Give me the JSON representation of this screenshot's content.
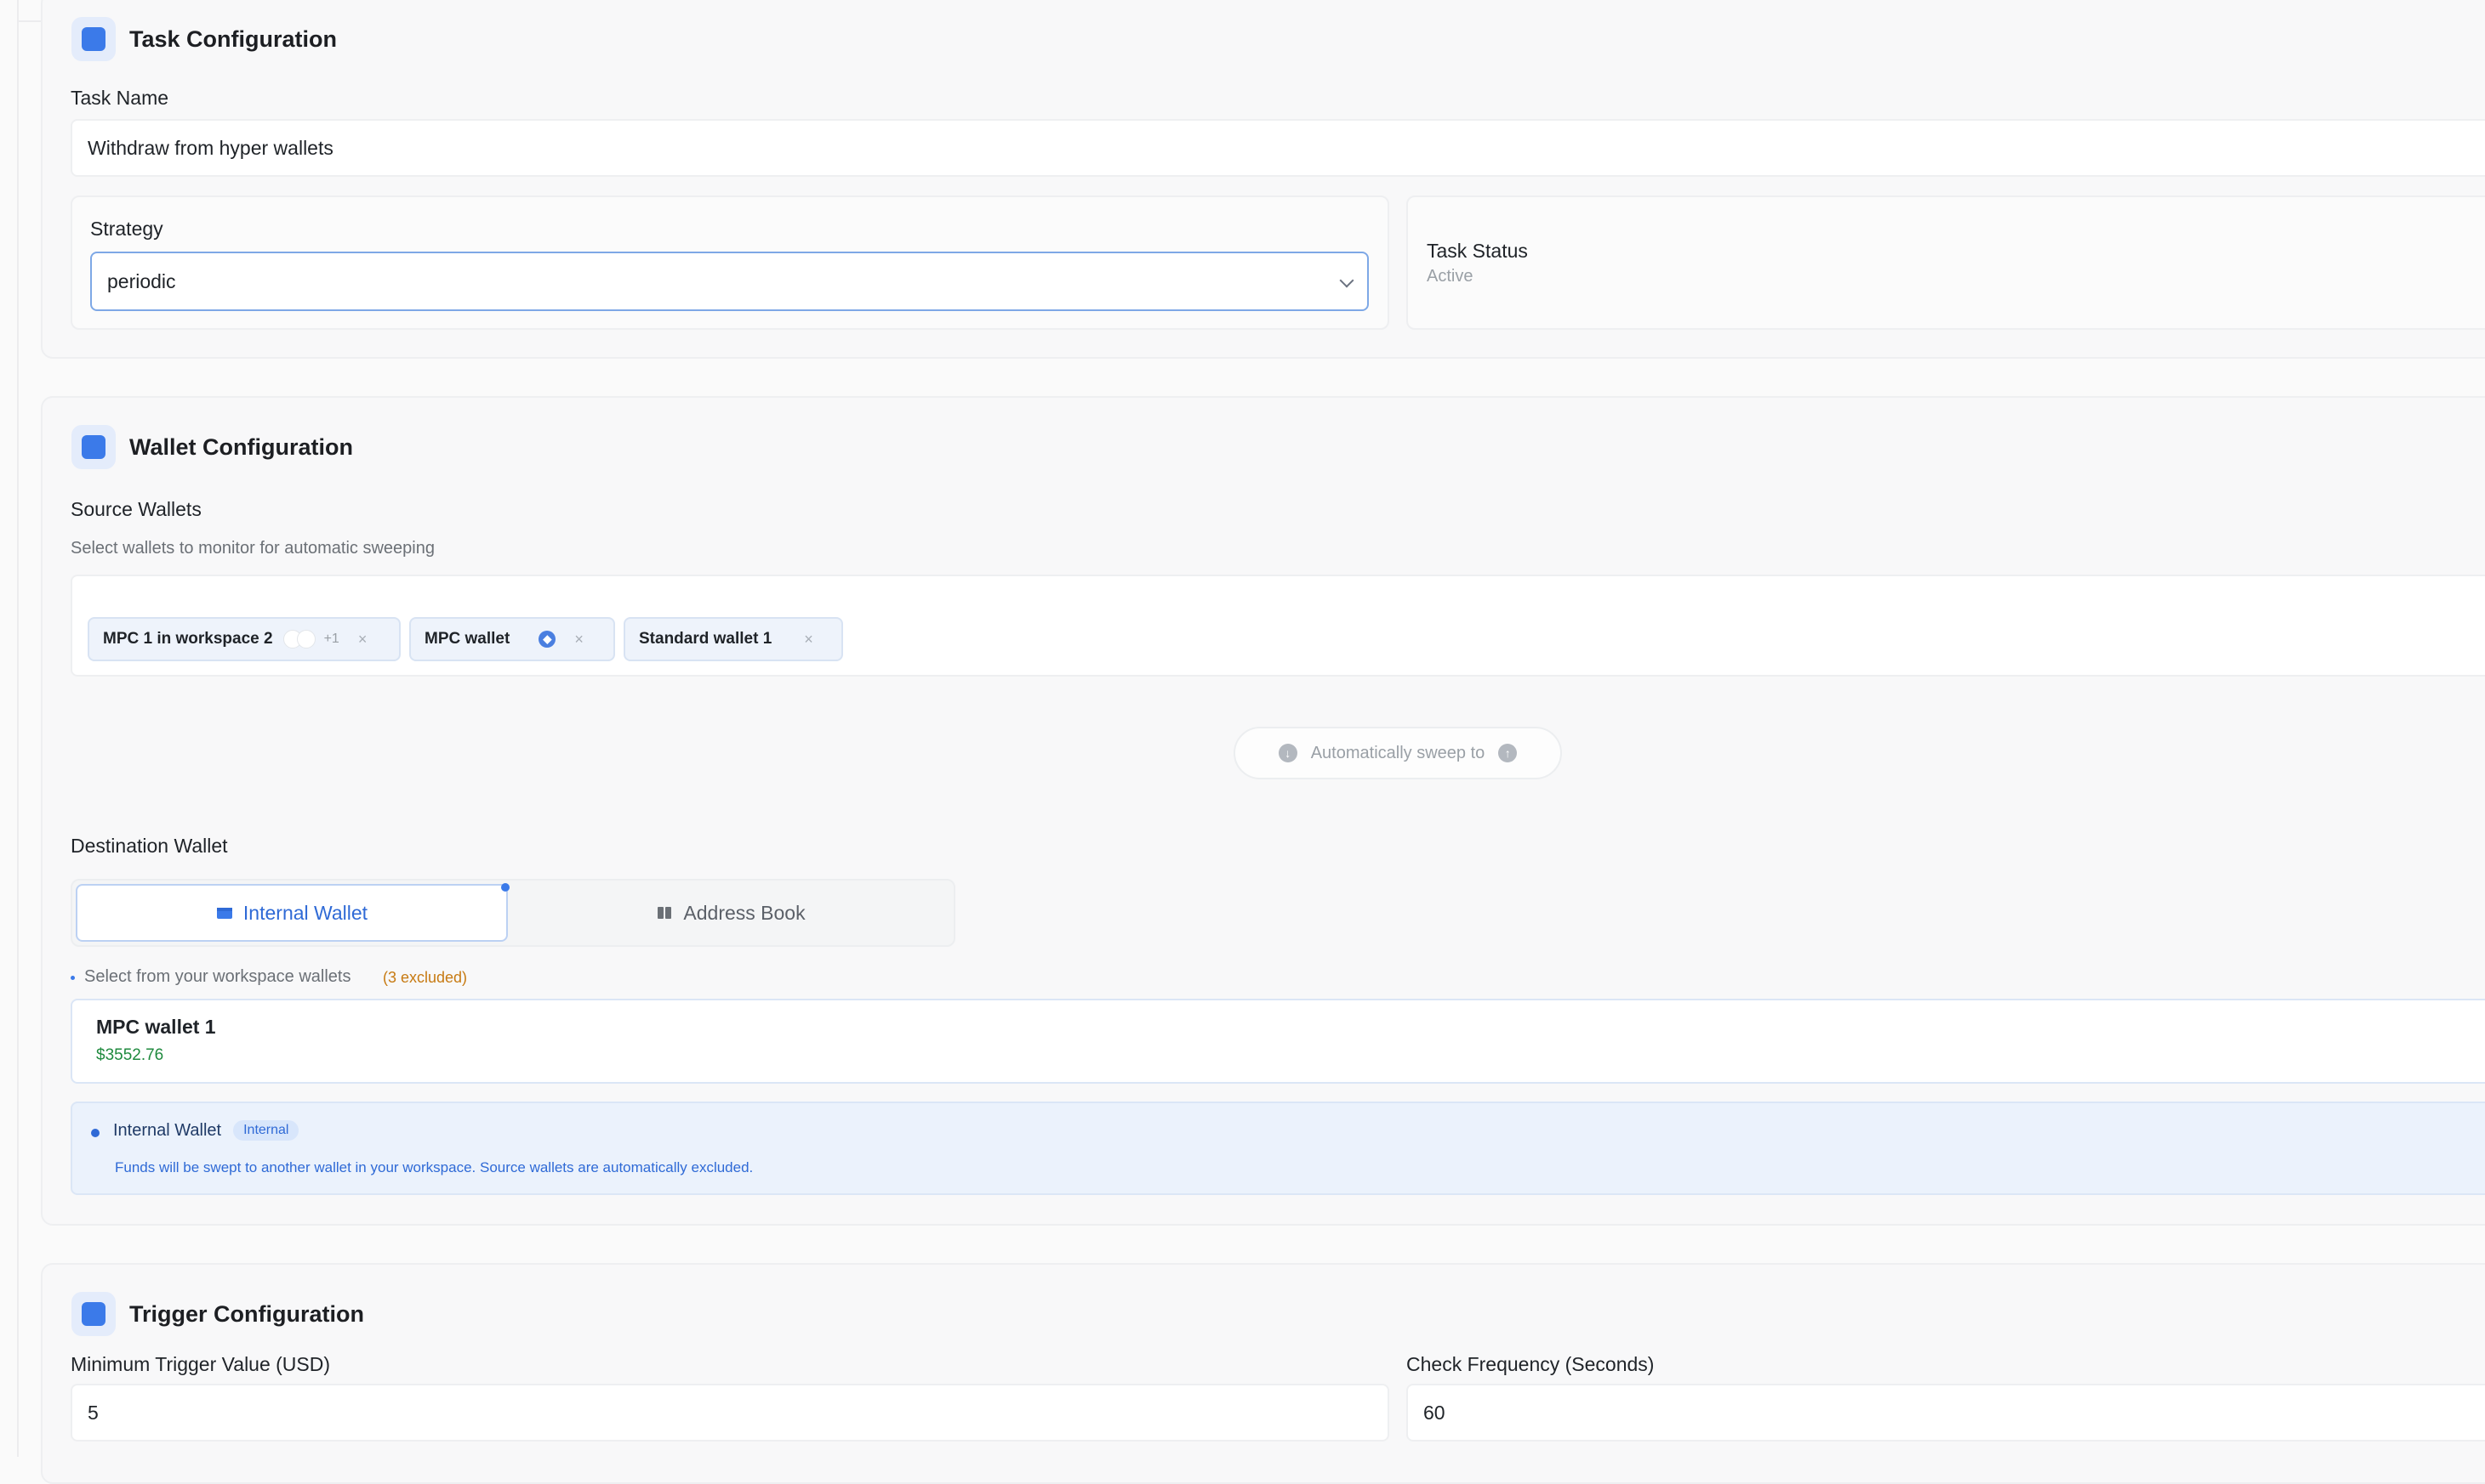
{
  "task_config": {
    "title": "Task Configuration",
    "task_name_label": "Task Name",
    "task_name_value": "Withdraw from hyper wallets",
    "strategy_label": "Strategy",
    "strategy_value": "periodic",
    "status_label": "Task Status",
    "status_value": "Active"
  },
  "wallet_config": {
    "title": "Wallet Configuration",
    "source_label": "Source Wallets",
    "source_desc": "Select wallets to monitor for automatic sweeping",
    "source_wallets": [
      {
        "name": "MPC 1 in workspace 2",
        "extra": "+1",
        "remove": "×"
      },
      {
        "name": "MPC wallet",
        "remove": "×"
      },
      {
        "name": "Standard wallet 1",
        "remove": "×"
      }
    ],
    "sweep_label": "Automatically sweep to",
    "destination_label": "Destination Wallet",
    "tabs": [
      {
        "label": "Internal Wallet",
        "icon": "wallet-icon"
      },
      {
        "label": "Address Book",
        "icon": "book-icon"
      }
    ],
    "select_hint": "Select from your workspace wallets",
    "excluded_note": "(3 excluded)",
    "selected_wallet": {
      "name": "MPC wallet 1",
      "balance": "$3552.76"
    },
    "notice": {
      "title": "Internal Wallet",
      "badge": "Internal",
      "text": "Funds will be swept to another wallet in your workspace. Source wallets are automatically excluded."
    }
  },
  "trigger_config": {
    "title": "Trigger Configuration",
    "min_value_label": "Minimum Trigger Value (USD)",
    "min_value": "5",
    "frequency_label": "Check Frequency (Seconds)",
    "frequency_value": "60"
  },
  "colors": {
    "accent": "#3b7ae9",
    "success": "#1f8a3e",
    "warning": "#c77a12",
    "notice_bg": "#ebf2fc"
  }
}
